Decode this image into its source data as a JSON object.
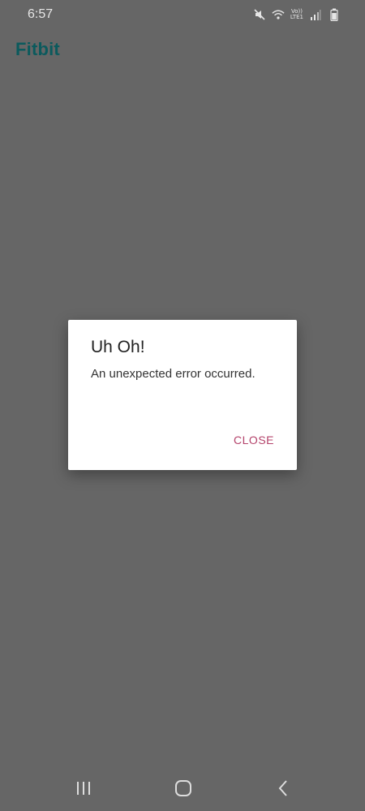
{
  "status_bar": {
    "time": "6:57",
    "icons": [
      "mute-icon",
      "wifi-icon",
      "volte-icon",
      "signal-icon",
      "battery-icon"
    ],
    "volte_text_top": "Vo))",
    "volte_text_bottom": "LTE1"
  },
  "app": {
    "title": "Fitbit",
    "title_color": "#0b5a5d"
  },
  "dialog": {
    "title": "Uh Oh!",
    "message": "An unexpected error occurred.",
    "close_label": "CLOSE",
    "accent_color": "#b4436b"
  },
  "nav_bar": {
    "icons": [
      "recent-apps-icon",
      "home-icon",
      "back-icon"
    ]
  },
  "colors": {
    "overlay_background": "#666666"
  }
}
